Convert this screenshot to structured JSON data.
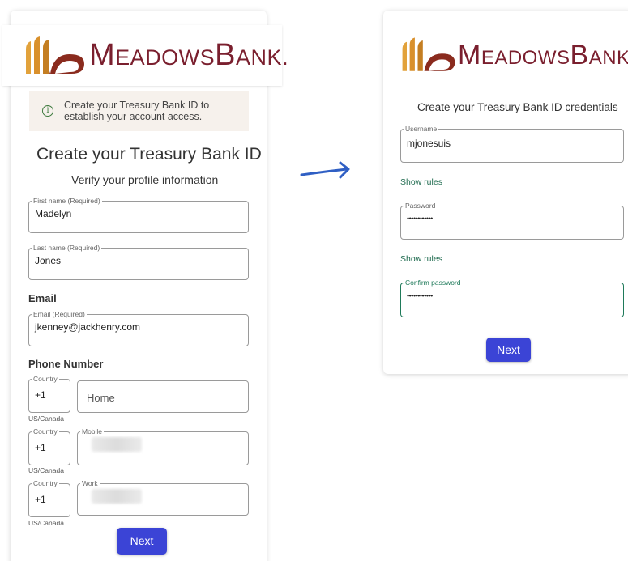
{
  "brand": {
    "logo_text_first": "M",
    "logo_text_mid": "EADOWS",
    "logo_text_b": "B",
    "logo_text_end": "ANK",
    "logo_dot": ".",
    "color": "#7a1f2e"
  },
  "left": {
    "info": "Create your Treasury Bank ID to establish your account access.",
    "title": "Create your Treasury Bank ID",
    "subtitle": "Verify your profile information",
    "first_name": {
      "label": "First name (Required)",
      "value": "Madelyn"
    },
    "last_name": {
      "label": "Last name (Required)",
      "value": "Jones"
    },
    "email_heading": "Email",
    "email": {
      "label": "Email (Required)",
      "value": "jkenney@jackhenry.com"
    },
    "phone_heading": "Phone Number",
    "phones": [
      {
        "country_label": "Country",
        "country_value": "+1",
        "country_sub": "US/Canada",
        "type_label": "",
        "type_value": "Home"
      },
      {
        "country_label": "Country",
        "country_value": "+1",
        "country_sub": "US/Canada",
        "type_label": "Mobile",
        "type_value": ""
      },
      {
        "country_label": "Country",
        "country_value": "+1",
        "country_sub": "US/Canada",
        "type_label": "Work",
        "type_value": ""
      }
    ],
    "next": "Next"
  },
  "right": {
    "title": "Create your Treasury Bank ID credentials",
    "username": {
      "label": "Username",
      "value": "mjonesuis"
    },
    "show_rules_1": "Show rules",
    "password": {
      "label": "Password",
      "value": "••••••••••••"
    },
    "show_rules_2": "Show rules",
    "confirm": {
      "label": "Confirm password",
      "value": "••••••••••••"
    },
    "next": "Next"
  },
  "colors": {
    "accent": "#3b44d6",
    "focus": "#1f7a5a",
    "arrow": "#2f5fc4"
  }
}
